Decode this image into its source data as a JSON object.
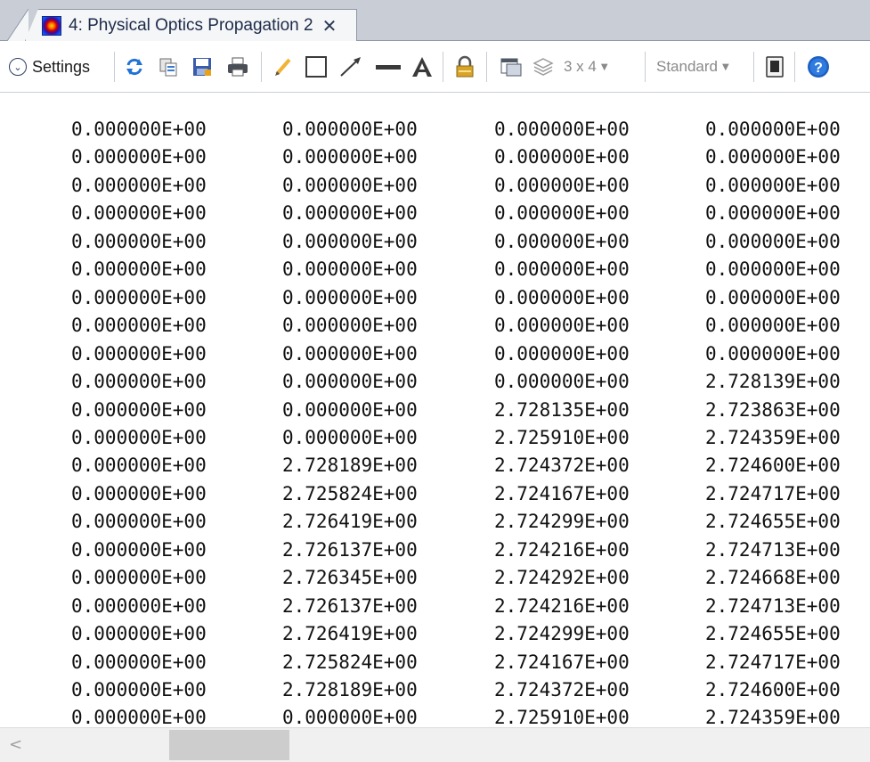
{
  "tab": {
    "icon": "psf-colormap-icon",
    "title": "4: Physical Optics Propagation 2",
    "close_glyph": "✕"
  },
  "toolbar": {
    "settings_label": "Settings",
    "grid_label": "3 x 4",
    "style_label": "Standard"
  },
  "table": {
    "rows": [
      [
        "0.000000E+00",
        "0.000000E+00",
        "0.000000E+00",
        "0.000000E+00"
      ],
      [
        "0.000000E+00",
        "0.000000E+00",
        "0.000000E+00",
        "0.000000E+00"
      ],
      [
        "0.000000E+00",
        "0.000000E+00",
        "0.000000E+00",
        "0.000000E+00"
      ],
      [
        "0.000000E+00",
        "0.000000E+00",
        "0.000000E+00",
        "0.000000E+00"
      ],
      [
        "0.000000E+00",
        "0.000000E+00",
        "0.000000E+00",
        "0.000000E+00"
      ],
      [
        "0.000000E+00",
        "0.000000E+00",
        "0.000000E+00",
        "0.000000E+00"
      ],
      [
        "0.000000E+00",
        "0.000000E+00",
        "0.000000E+00",
        "0.000000E+00"
      ],
      [
        "0.000000E+00",
        "0.000000E+00",
        "0.000000E+00",
        "0.000000E+00"
      ],
      [
        "0.000000E+00",
        "0.000000E+00",
        "0.000000E+00",
        "0.000000E+00"
      ],
      [
        "0.000000E+00",
        "0.000000E+00",
        "0.000000E+00",
        "2.728139E+00"
      ],
      [
        "0.000000E+00",
        "0.000000E+00",
        "2.728135E+00",
        "2.723863E+00"
      ],
      [
        "0.000000E+00",
        "0.000000E+00",
        "2.725910E+00",
        "2.724359E+00"
      ],
      [
        "0.000000E+00",
        "2.728189E+00",
        "2.724372E+00",
        "2.724600E+00"
      ],
      [
        "0.000000E+00",
        "2.725824E+00",
        "2.724167E+00",
        "2.724717E+00"
      ],
      [
        "0.000000E+00",
        "2.726419E+00",
        "2.724299E+00",
        "2.724655E+00"
      ],
      [
        "0.000000E+00",
        "2.726137E+00",
        "2.724216E+00",
        "2.724713E+00"
      ],
      [
        "0.000000E+00",
        "2.726345E+00",
        "2.724292E+00",
        "2.724668E+00"
      ],
      [
        "0.000000E+00",
        "2.726137E+00",
        "2.724216E+00",
        "2.724713E+00"
      ],
      [
        "0.000000E+00",
        "2.726419E+00",
        "2.724299E+00",
        "2.724655E+00"
      ],
      [
        "0.000000E+00",
        "2.725824E+00",
        "2.724167E+00",
        "2.724717E+00"
      ],
      [
        "0.000000E+00",
        "2.728189E+00",
        "2.724372E+00",
        "2.724600E+00"
      ],
      [
        "0.000000E+00",
        "0.000000E+00",
        "2.725910E+00",
        "2.724359E+00"
      ]
    ]
  },
  "scrollbar": {
    "left_arrow": "<"
  }
}
